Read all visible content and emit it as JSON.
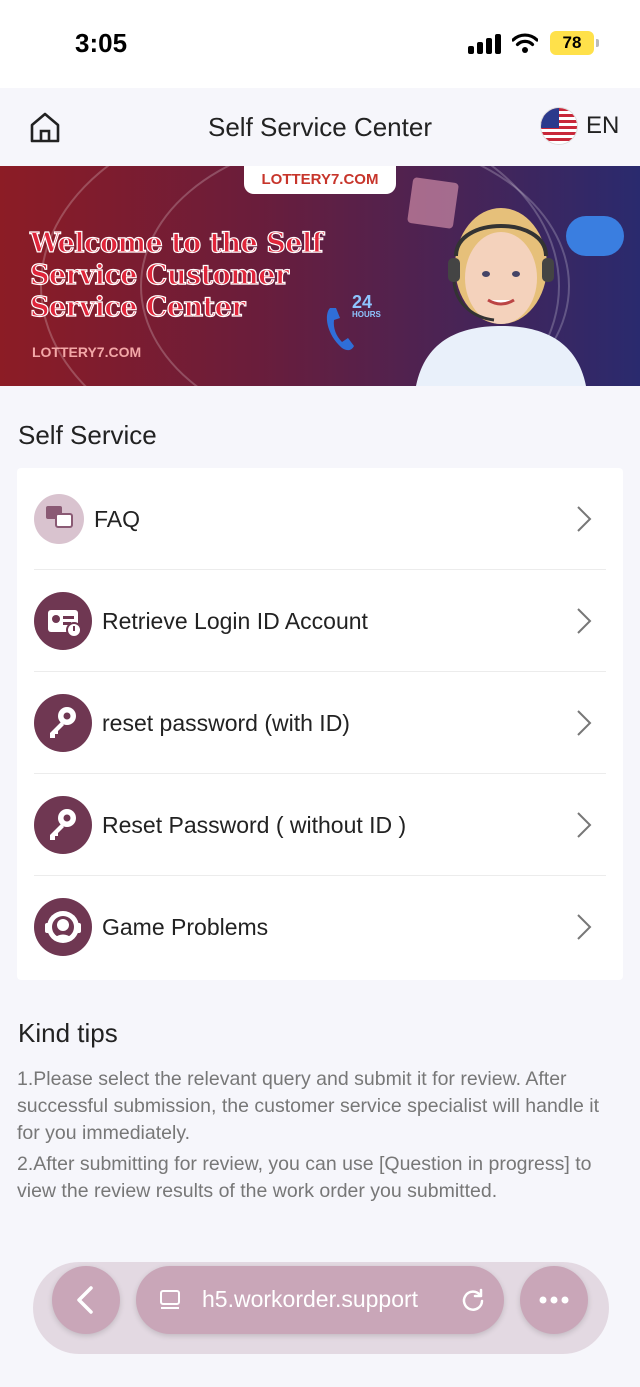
{
  "status_bar": {
    "time": "3:05",
    "battery": "78"
  },
  "header": {
    "title": "Self Service Center",
    "language": "EN"
  },
  "banner": {
    "brand": "LOTTERY7.COM",
    "welcome_line1": "Welcome to the Self",
    "welcome_line2": "Service Customer",
    "welcome_line3": "Service Center",
    "hours_number": "24",
    "hours_label": "HOURS"
  },
  "self_service": {
    "title": "Self Service",
    "items": [
      {
        "label": "FAQ",
        "icon": "faq-icon"
      },
      {
        "label": "Retrieve Login ID Account",
        "icon": "id-card-icon"
      },
      {
        "label": "reset password (with ID)",
        "icon": "key-icon"
      },
      {
        "label": "Reset Password ( without ID )",
        "icon": "key-icon"
      },
      {
        "label": "Game Problems",
        "icon": "headset-icon"
      }
    ]
  },
  "tips": {
    "title": "Kind tips",
    "tip1": "1.Please select the relevant query and submit it for review. After successful submission, the customer service specialist will handle it for you immediately.",
    "tip2": "2.After submitting for review, you can use [Question in progress] to view the review results of the work order you submitted."
  },
  "browser": {
    "url": "h5.workorder.support"
  }
}
